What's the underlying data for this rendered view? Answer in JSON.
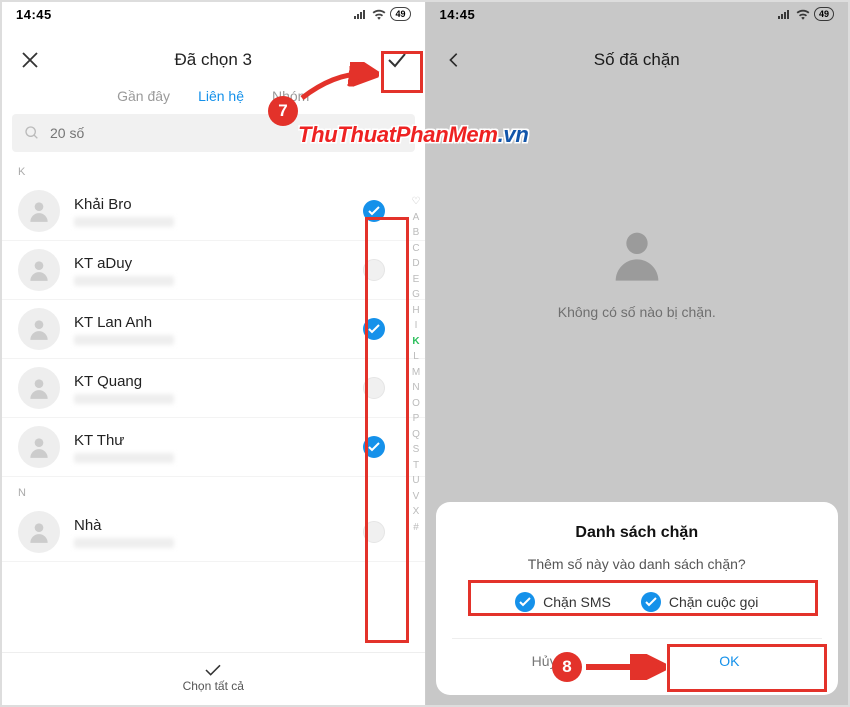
{
  "status": {
    "time": "14:45",
    "battery": "49"
  },
  "left": {
    "title": "Đã chọn 3",
    "tabs": {
      "recent": "Gần đây",
      "contacts": "Liên hệ",
      "groups": "Nhóm"
    },
    "search_placeholder": "20 số",
    "sections": [
      {
        "letter": "K",
        "items": [
          {
            "name": "Khải Bro",
            "selected": true
          },
          {
            "name": "KT aDuy",
            "selected": false
          },
          {
            "name": "KT Lan Anh",
            "selected": true
          },
          {
            "name": "KT Quang",
            "selected": false
          },
          {
            "name": "KT Thư",
            "selected": true
          }
        ]
      },
      {
        "letter": "N",
        "items": [
          {
            "name": "Nhà",
            "selected": false
          }
        ]
      }
    ],
    "alpha_index": [
      "♡",
      "A",
      "B",
      "C",
      "D",
      "E",
      "G",
      "H",
      "I",
      "K",
      "L",
      "M",
      "N",
      "O",
      "P",
      "Q",
      "S",
      "T",
      "U",
      "V",
      "X",
      "#"
    ],
    "alpha_active": "K",
    "select_all_label": "Chọn tất cả"
  },
  "right": {
    "title": "Số đã chặn",
    "empty_text": "Không có số nào bị chặn.",
    "sheet": {
      "title": "Danh sách chặn",
      "message": "Thêm số này vào danh sách chặn?",
      "opt_sms": "Chặn SMS",
      "opt_call": "Chặn cuộc gọi",
      "cancel": "Hủy",
      "ok": "OK"
    }
  },
  "annotations": {
    "step7": "7",
    "step8": "8",
    "watermark_a": "ThuThuatPhanMem",
    "watermark_b": ".vn"
  }
}
